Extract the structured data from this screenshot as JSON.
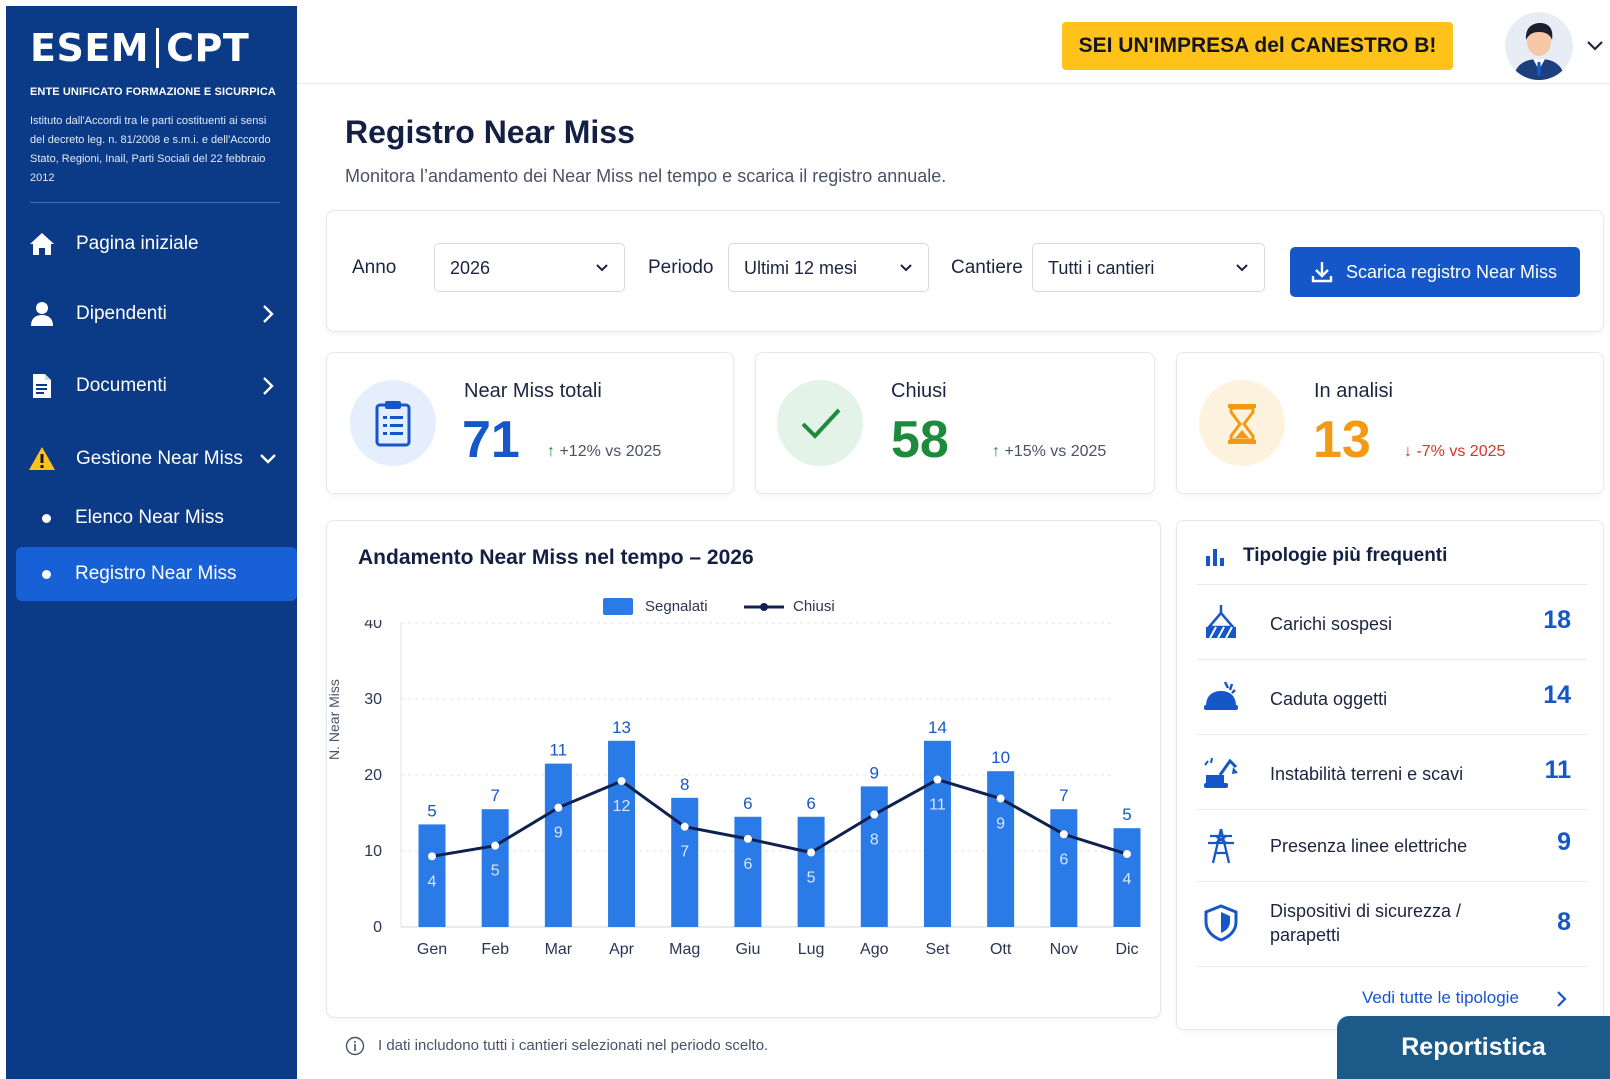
{
  "brand": {
    "logo_left": "ESEM",
    "logo_right": "CPT",
    "org_name": "ENTE UNIFICATO FORMAZIONE E SICURPICA",
    "org_desc": "Istituto dall'Accordi tra le parti costituenti ai sensi del decreto leg. n. 81/2008 e s.m.i. e dell'Accordo Stato, Regioni, Inail, Parti Sociali del 22 febbraio 2012"
  },
  "sidebar": {
    "items": [
      {
        "label": "Pagina iniziale",
        "icon": "home-icon"
      },
      {
        "label": "Dipendenti",
        "icon": "user-icon"
      },
      {
        "label": "Documenti",
        "icon": "document-icon"
      },
      {
        "label": "Gestione Near Miss",
        "icon": "warning-icon"
      }
    ],
    "subitems": [
      {
        "label": "Elenco Near Miss",
        "active": false
      },
      {
        "label": "Registro Near Miss",
        "active": true
      }
    ],
    "bg_color": "#0b3a86",
    "active_color": "#1760d6"
  },
  "header": {
    "banner": "SEI UN'IMPRESA del CANESTRO B!",
    "banner_color": "#ffc21a"
  },
  "page": {
    "title": "Registro Near Miss",
    "subtitle": "Monitora l’andamento dei Near Miss nel tempo e scarica il registro annuale."
  },
  "filters": {
    "anno_label": "Anno",
    "anno_value": "2026",
    "periodo_label": "Periodo",
    "periodo_value": "Ultimi 12 mesi",
    "cantiere_label": "Cantiere",
    "cantiere_value": "Tutti i cantieri",
    "download_label": "Scarica registro Near Miss"
  },
  "kpis": [
    {
      "label": "Near Miss totali",
      "value": "71",
      "trend": "+12% vs 2025",
      "direction": "up",
      "color": "#1557c8",
      "icon": "clipboard-icon"
    },
    {
      "label": "Chiusi",
      "value": "58",
      "trend": "+15% vs 2025",
      "direction": "up",
      "color": "#1e8a3c",
      "icon": "check-icon"
    },
    {
      "label": "In analisi",
      "value": "13",
      "trend": "-7% vs 2025",
      "direction": "down",
      "color": "#f39a12",
      "icon": "hourglass-icon"
    }
  ],
  "chart_data": {
    "type": "bar",
    "title": "Andamento Near Miss nel tempo – 2026",
    "ylabel": "N. Near Miss",
    "xlabel": "",
    "ylim": [
      0,
      40
    ],
    "yticks": [
      0,
      10,
      20,
      30,
      40
    ],
    "grid": true,
    "legend_position": "top-center",
    "categories": [
      "Gen",
      "Feb",
      "Mar",
      "Apr",
      "Mag",
      "Giu",
      "Lug",
      "Ago",
      "Set",
      "Ott",
      "Nov",
      "Dic"
    ],
    "series": [
      {
        "name": "Segnalati",
        "type": "bar",
        "color": "#2a7be8",
        "values": [
          5,
          7,
          11,
          13,
          8,
          6,
          6,
          9,
          14,
          10,
          7,
          5
        ],
        "bar_heights": [
          13.5,
          15.5,
          21.5,
          24.5,
          17,
          14.5,
          14.5,
          18.5,
          24.5,
          20.5,
          15.5,
          13
        ]
      },
      {
        "name": "Chiusi",
        "type": "line",
        "color": "#10214f",
        "values": [
          4,
          5,
          9,
          12,
          7,
          6,
          5,
          8,
          11,
          9,
          6,
          4
        ],
        "line_y": [
          9.3,
          10.7,
          15.7,
          19.2,
          13.2,
          11.6,
          9.8,
          14.8,
          19.4,
          16.9,
          12.2,
          9.6
        ]
      }
    ]
  },
  "types_panel": {
    "title": "Tipologie più frequenti",
    "items": [
      {
        "label": "Carichi sospesi",
        "value": "18",
        "icon": "crane-load-icon"
      },
      {
        "label": "Caduta oggetti",
        "value": "14",
        "icon": "hardhat-falling-icon"
      },
      {
        "label": "Instabilità terreni e scavi",
        "value": "11",
        "icon": "excavator-icon"
      },
      {
        "label": "Presenza linee elettriche",
        "value": "9",
        "icon": "power-tower-icon"
      },
      {
        "label": "Dispositivi di sicurezza / parapetti",
        "value": "8",
        "icon": "shield-icon"
      }
    ],
    "see_all": "Vedi tutte le tipologie"
  },
  "note": "I dati includono tutti i cantieri selezionati nel periodo scelto.",
  "report_tab": "Reportistica"
}
